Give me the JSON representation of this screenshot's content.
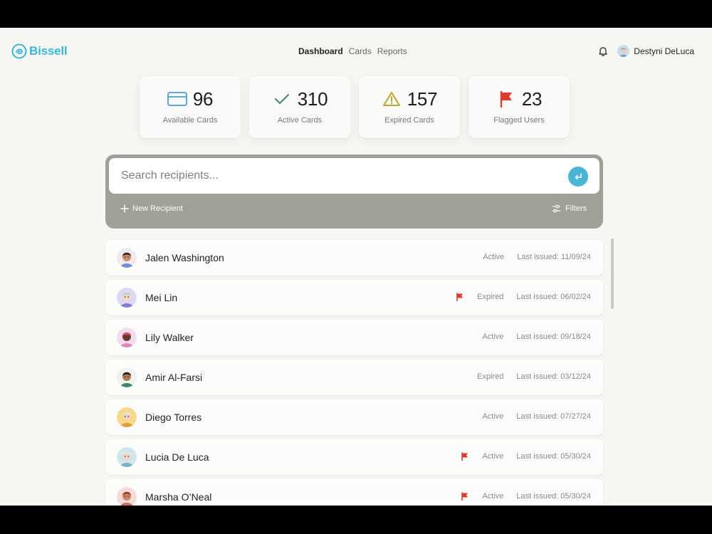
{
  "app": {
    "name": "Bissell",
    "accent": "#3bb7d6"
  },
  "nav": [
    {
      "label": "Dashboard",
      "active": true
    },
    {
      "label": "Cards",
      "active": false
    },
    {
      "label": "Reports",
      "active": false
    }
  ],
  "user": {
    "name": "Destyni DeLuca",
    "icon": "bell-icon"
  },
  "stats": [
    {
      "icon": "credit-card-icon",
      "value": "96",
      "label": "Available Cards",
      "color": "#5aa9e6"
    },
    {
      "icon": "check-icon",
      "value": "310",
      "label": "Active Cards",
      "color": "#3d8a6b"
    },
    {
      "icon": "warning-icon",
      "value": "157",
      "label": "Expired Cards",
      "color": "#b8a62e"
    },
    {
      "icon": "flag-icon",
      "value": "23",
      "label": "Flagged Users",
      "color": "#e03a2e"
    }
  ],
  "search": {
    "placeholder": "Search recipients..."
  },
  "actions": {
    "new_recipient": "New Recipient",
    "filters": "Filters"
  },
  "recipients": [
    {
      "name": "Jalen Washington",
      "status": "Active",
      "last_issued": "Last issued: 11/09/24",
      "flagged": false
    },
    {
      "name": "Mei Lin",
      "status": "Expired",
      "last_issued": "Last issued: 06/02/24",
      "flagged": true
    },
    {
      "name": "Lily Walker",
      "status": "Active",
      "last_issued": "Last issued: 09/18/24",
      "flagged": false
    },
    {
      "name": "Amir Al-Farsi",
      "status": "Expired",
      "last_issued": "Last issued: 03/12/24",
      "flagged": false
    },
    {
      "name": "Diego Torres",
      "status": "Active",
      "last_issued": "Last issued: 07/27/24",
      "flagged": false
    },
    {
      "name": "Lucia De Luca",
      "status": "Active",
      "last_issued": "Last issued: 05/30/24",
      "flagged": true
    },
    {
      "name": "Marsha O’Neal",
      "status": "Active",
      "last_issued": "Last issued: 05/30/24",
      "flagged": true
    }
  ]
}
